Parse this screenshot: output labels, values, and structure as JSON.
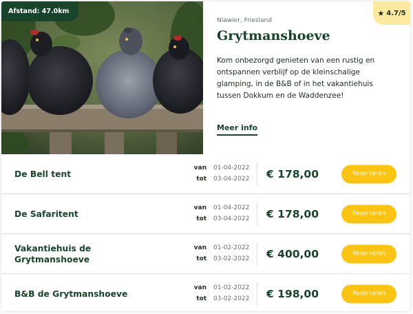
{
  "listing": {
    "distance_badge": "Afstand: 47.0km",
    "rating": "4.7/5",
    "rating_icon": "star-icon",
    "location": "Niawier, Friesland",
    "title": "Grytmanshoeve",
    "description": "Kom onbezorgd genieten van een rustig en ontspannen verblijf op de kleinschalige glamping, in de B&B of in het vakantiehuis tussen Dokkum en de Waddenzee!",
    "more_info": "Meer info",
    "photo_subject": "chickens-on-fence-photo"
  },
  "labels": {
    "from": "van",
    "to": "tot",
    "reserve": "Reserveren"
  },
  "offers": [
    {
      "name": "De Bell tent",
      "from": "01-04-2022",
      "to": "03-04-2022",
      "price": "€ 178,00"
    },
    {
      "name": "De Safaritent",
      "from": "01-04-2022",
      "to": "03-04-2022",
      "price": "€ 178,00"
    },
    {
      "name": "Vakantiehuis de Grytmanshoeve",
      "from": "01-02-2022",
      "to": "03-02-2022",
      "price": "€ 400,00"
    },
    {
      "name": "B&B de Grytmanshoeve",
      "from": "01-02-2022",
      "to": "03-02-2022",
      "price": "€ 198,00"
    }
  ],
  "colors": {
    "brand_green": "#17442b",
    "button_yellow": "#fcc313",
    "rating_bg": "#fde9a0"
  }
}
